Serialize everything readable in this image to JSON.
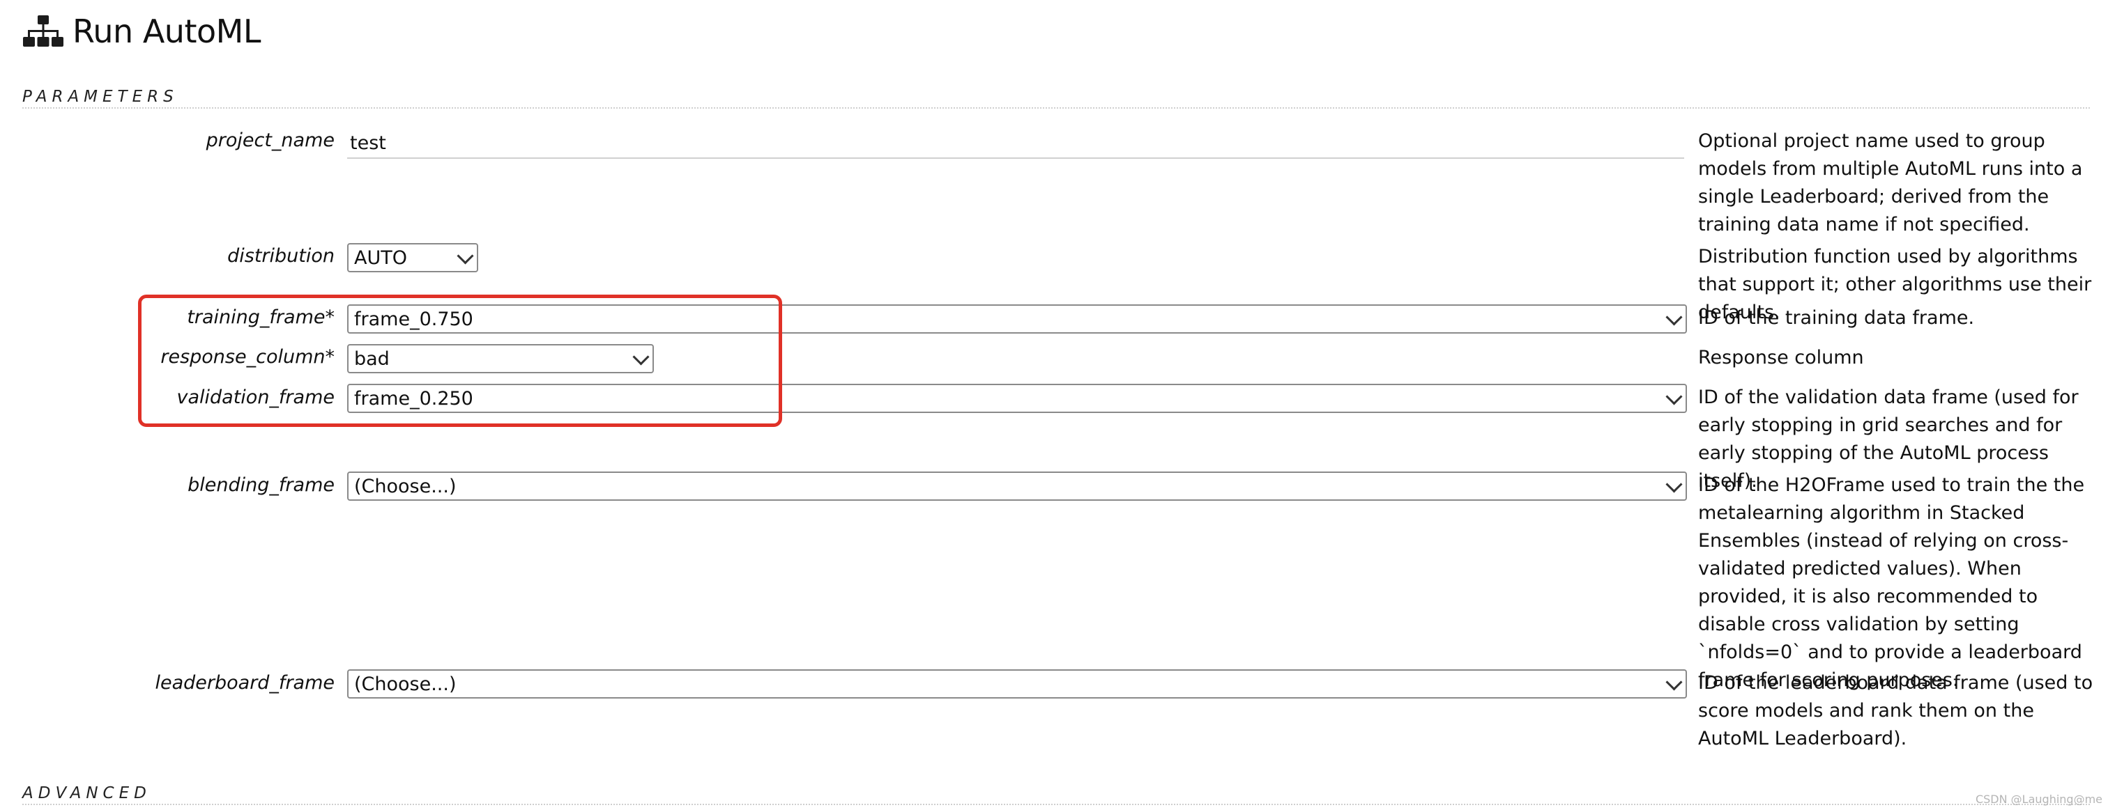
{
  "header": {
    "title": "Run AutoML",
    "icon": "sitemap-icon"
  },
  "sections": {
    "parameters": "PARAMETERS",
    "advanced": "ADVANCED"
  },
  "fields": {
    "project_name": {
      "label": "project_name",
      "value": "test",
      "help": "Optional project name used to group models from multiple AutoML runs into a single Leaderboard; derived from the training data name if not specified."
    },
    "distribution": {
      "label": "distribution",
      "value": "AUTO",
      "help": "Distribution function used by algorithms that support it; other algorithms use their defaults."
    },
    "training_frame": {
      "label": "training_frame*",
      "value": "frame_0.750",
      "help": "ID of the training data frame."
    },
    "response_column": {
      "label": "response_column*",
      "value": "bad",
      "help": "Response column"
    },
    "validation_frame": {
      "label": "validation_frame",
      "value": "frame_0.250",
      "help": "ID of the validation data frame (used for early stopping in grid searches and for early stopping of the AutoML process itself)."
    },
    "blending_frame": {
      "label": "blending_frame",
      "value": "(Choose...)",
      "help": "ID of the H2OFrame used to train the the metalearning algorithm in Stacked Ensembles (instead of relying on cross-validated predicted values). When provided, it is also recommended to disable cross validation by setting `nfolds=0` and to provide a leaderboard frame for scoring purposes."
    },
    "leaderboard_frame": {
      "label": "leaderboard_frame",
      "value": "(Choose...)",
      "help": "ID of the leaderboard data frame (used to score models and rank them on the AutoML Leaderboard)."
    }
  },
  "annotation": {
    "color": "#e03127"
  },
  "watermark": "CSDN @Laughing@me"
}
